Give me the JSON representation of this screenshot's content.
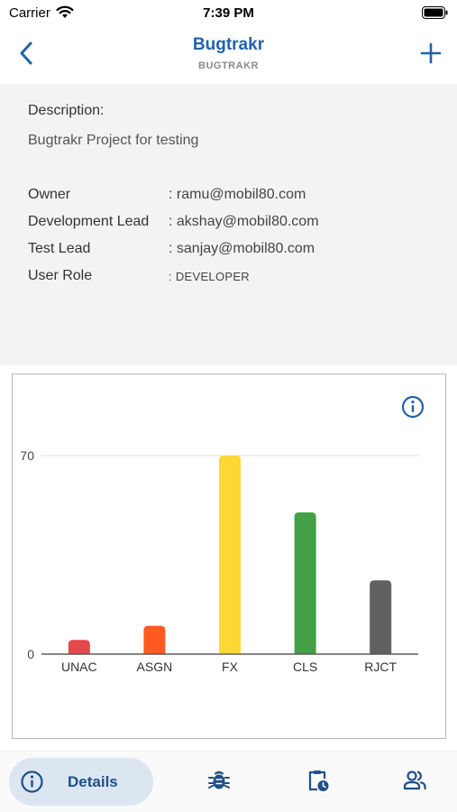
{
  "status_bar": {
    "carrier": "Carrier",
    "time": "7:39 PM",
    "icons": [
      "wifi-icon",
      "battery-icon"
    ]
  },
  "nav": {
    "title": "Bugtrakr",
    "subtitle": "BUGTRAKR",
    "back_icon": "chevron-left-icon",
    "add_icon": "plus-icon"
  },
  "details": {
    "description_label": "Description:",
    "description_value": "Bugtrakr Project for testing",
    "rows": [
      {
        "key": "Owner",
        "value": ": ramu@mobil80.com"
      },
      {
        "key": "Development Lead",
        "value": ": akshay@mobil80.com"
      },
      {
        "key": "Test Lead",
        "value": ": sanjay@mobil80.com"
      },
      {
        "key": "User Role",
        "value": ": DEVELOPER"
      }
    ]
  },
  "chart_data": {
    "type": "bar",
    "categories": [
      "UNAC",
      "ASGN",
      "FX",
      "CLS",
      "RJCT"
    ],
    "values": [
      5,
      10,
      70,
      50,
      26
    ],
    "colors": [
      "#e5484d",
      "#ff5a1f",
      "#fdd835",
      "#43a047",
      "#616161"
    ],
    "yticks": [
      0,
      70
    ],
    "ylim": [
      0,
      70
    ],
    "grid": true,
    "legend": false
  },
  "tabs": {
    "details_label": "Details",
    "icons": [
      "info-icon",
      "bug-icon",
      "clipboard-clock-icon",
      "users-icon"
    ]
  },
  "colors": {
    "accent": "#1f63ab",
    "panel_bg": "#f3f3f3",
    "tab_active_bg": "#dce6f1"
  }
}
